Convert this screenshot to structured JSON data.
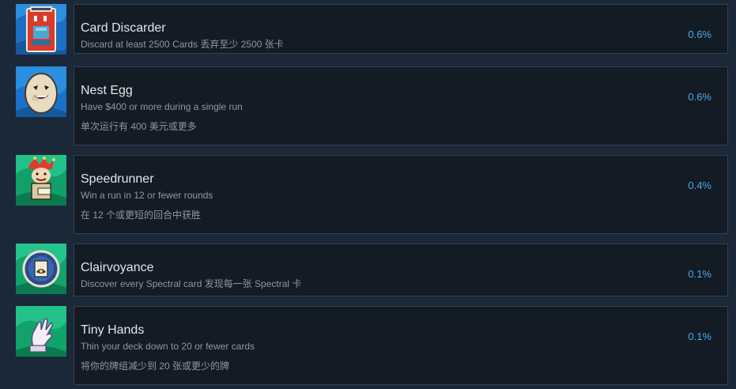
{
  "achievements": [
    {
      "title": "Card Discarder",
      "desc": "Discard at least 2500 Cards 丢弃至少 2500 张卡",
      "desc2": "",
      "percent": "0.6%",
      "icon": "card-discarder-icon"
    },
    {
      "title": "Nest Egg",
      "desc": "Have $400 or more during a single run",
      "desc2": "单次运行有 400 美元或更多",
      "percent": "0.6%",
      "icon": "nest-egg-icon"
    },
    {
      "title": "Speedrunner",
      "desc": "Win a run in 12 or fewer rounds",
      "desc2": "在 12 个或更短的回合中获胜",
      "percent": "0.4%",
      "icon": "speedrunner-icon"
    },
    {
      "title": "Clairvoyance",
      "desc": "Discover every Spectral card 发现每一张 Spectral 卡",
      "desc2": "",
      "percent": "0.1%",
      "icon": "clairvoyance-icon"
    },
    {
      "title": "Tiny Hands",
      "desc": "Thin your deck down to 20 or fewer cards",
      "desc2": "将你的牌组减少到 20 张或更少的牌",
      "percent": "0.1%",
      "icon": "tiny-hands-icon"
    }
  ],
  "colors": {
    "background": "#1b2838",
    "card": "#131b24",
    "border": "#2f4354",
    "title": "#e3e7eb",
    "description": "#8f98a0",
    "percent": "#4fa9e8"
  }
}
